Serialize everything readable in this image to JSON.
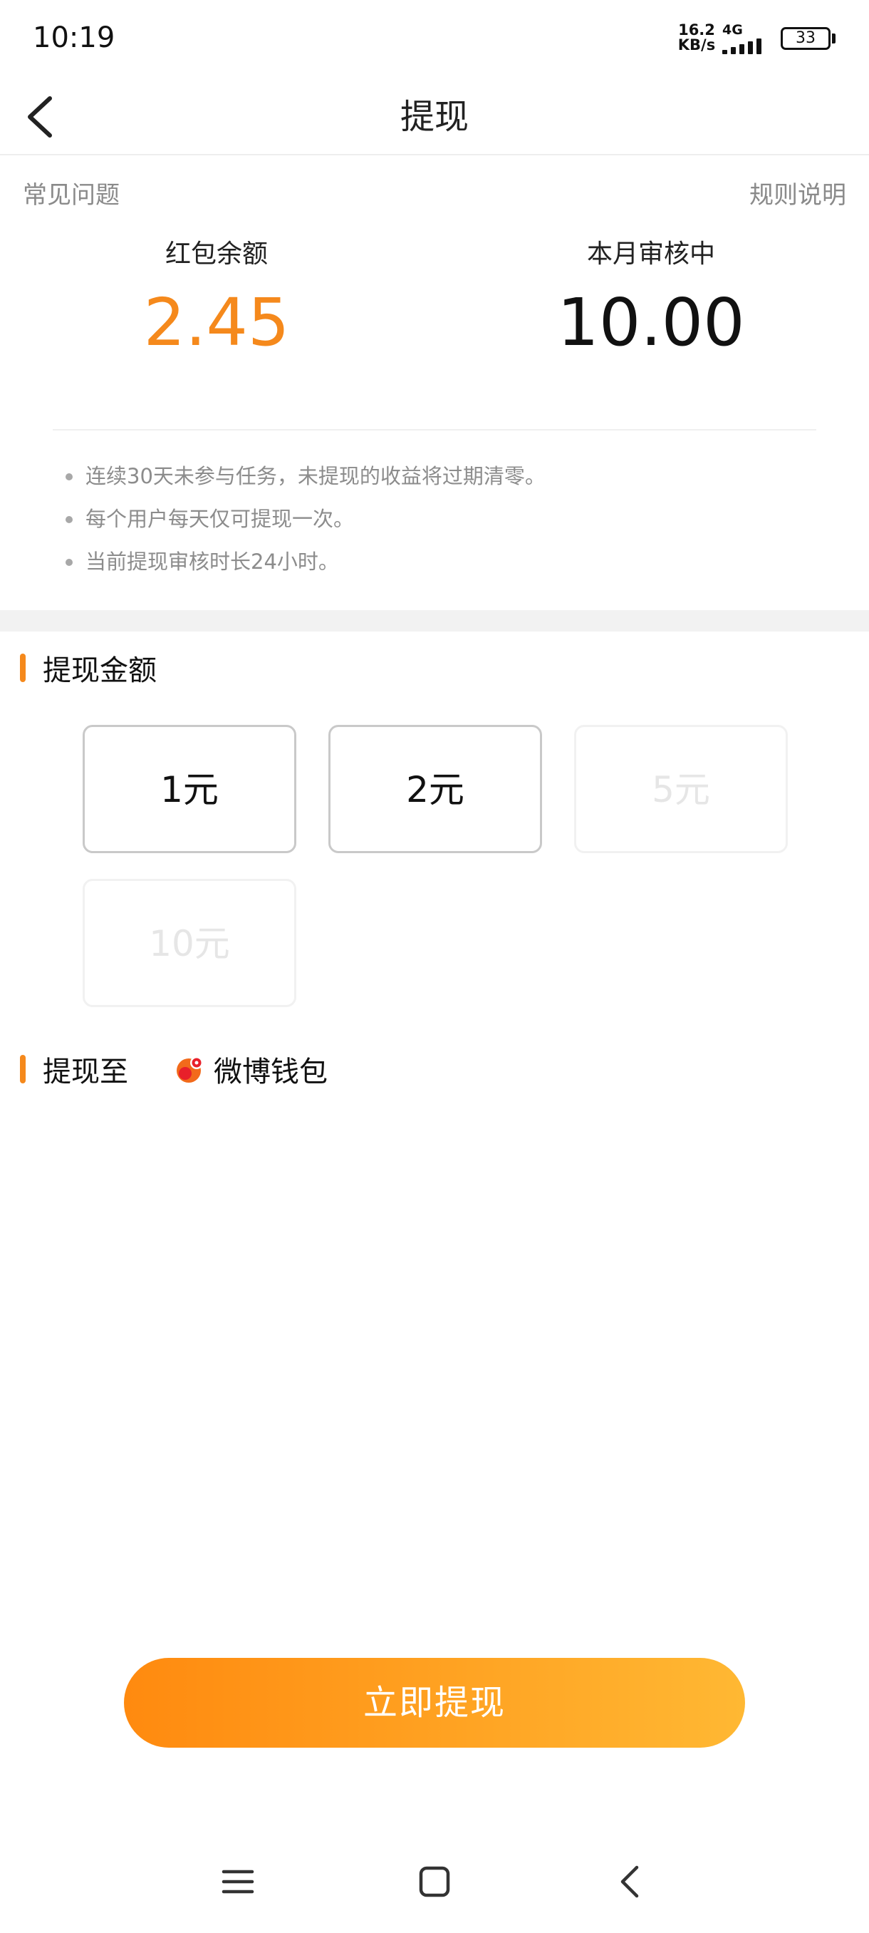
{
  "status_bar": {
    "time": "10:19",
    "net_speed_value": "16.2",
    "net_speed_unit": "KB/s",
    "network_type": "4G",
    "battery_level": "33"
  },
  "nav": {
    "title": "提现",
    "back_icon": "chevron-left-icon"
  },
  "links": {
    "faq": "常见问题",
    "rules": "规则说明"
  },
  "balances": {
    "red_packet_label": "红包余额",
    "red_packet_value": "2.45",
    "under_review_label": "本月审核中",
    "under_review_value": "10.00"
  },
  "notes": [
    "连续30天未参与任务，未提现的收益将过期清零。",
    "每个用户每天仅可提现一次。",
    "当前提现审核时长24小时。"
  ],
  "amount_section": {
    "title": "提现金额",
    "options": [
      {
        "label": "1元",
        "enabled": true
      },
      {
        "label": "2元",
        "enabled": true
      },
      {
        "label": "5元",
        "enabled": false
      },
      {
        "label": "10元",
        "enabled": false
      }
    ]
  },
  "destination_section": {
    "title": "提现至",
    "wallet_label": "微博钱包",
    "wallet_icon": "weibo-wallet-icon"
  },
  "withdraw_button": {
    "label": "立即提现"
  },
  "colors": {
    "accent": "#f5891c",
    "button_gradient_start": "#ff8a0f",
    "button_gradient_end": "#ffb833"
  },
  "system_nav": {
    "icons": [
      "menu-icon",
      "home-icon",
      "back-icon"
    ]
  }
}
